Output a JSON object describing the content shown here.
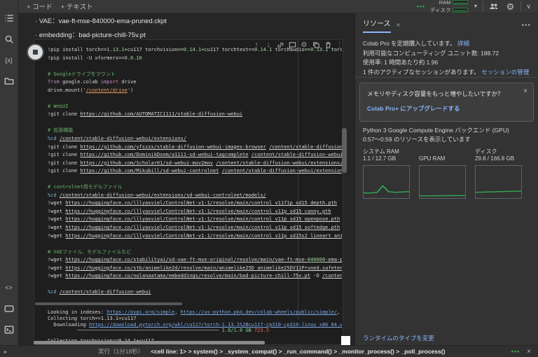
{
  "topbar": {
    "add_code": "+ コード",
    "add_text": "+ テキスト",
    "exec_dots": "•••",
    "ram_label": "RAM",
    "disk_label": "ディスク",
    "accent_green": "#34a853"
  },
  "markdown": {
    "bullet": "·",
    "line1": "VAE：vae-ft-mse-840000-ema-pruned.ckpt",
    "line2": "embedding：bad-picture-chill-75v.pt"
  },
  "cell": {
    "lines": [
      [
        [
          "pl",
          "!pip install torch=="
        ],
        [
          "nu",
          "1.13.1"
        ],
        [
          "pl",
          "+cu117 torchvision=="
        ],
        [
          "nu",
          "0.14.1"
        ],
        [
          "pl",
          "+cu117 torchtext=="
        ],
        [
          "nu",
          "0.14.1"
        ],
        [
          "pl",
          " torchaudio=="
        ],
        [
          "nu",
          "0.13.1"
        ],
        [
          "pl",
          " torch"
        ]
      ],
      [
        [
          "pl",
          "!pip install -U xformers=="
        ],
        [
          "nu",
          "0.0.16"
        ]
      ],
      [],
      [
        [
          "cm",
          "# Googleドライブをマウント"
        ]
      ],
      [
        [
          "kw",
          "from"
        ],
        [
          "pl",
          " google.colab "
        ],
        [
          "kw",
          "import"
        ],
        [
          "pl",
          " drive"
        ]
      ],
      [
        [
          "pl",
          "drive.mount("
        ],
        [
          "st",
          "'"
        ],
        [
          "stlk",
          "/content/drive"
        ],
        [
          "st",
          "'"
        ],
        [
          "pl",
          ")"
        ]
      ],
      [],
      [
        [
          "cm",
          "# WebUI"
        ]
      ],
      [
        [
          "pl",
          "!git clone "
        ],
        [
          "lk",
          "https://github.com/AUTOMATIC1111/stable-diffusion-webui"
        ]
      ],
      [],
      [
        [
          "cm",
          "# 拡張機能"
        ]
      ],
      [
        [
          "mg",
          "%cd"
        ],
        [
          "pl",
          " "
        ],
        [
          "lk",
          "/content/stable-diffusion-webui/extensions/"
        ]
      ],
      [
        [
          "pl",
          "!git clone "
        ],
        [
          "lk",
          "https://github.com/yfszzx/stable-diffusion-webui-images-browser"
        ],
        [
          "pl",
          " "
        ],
        [
          "lk",
          "/content/stable-diffusion-"
        ]
      ],
      [
        [
          "pl",
          "!git clone "
        ],
        [
          "lk",
          "https://github.com/DominikDoom/a1111-sd-webui-tagcomplete"
        ],
        [
          "pl",
          " "
        ],
        [
          "lk",
          "/content/stable-diffusion-webui/"
        ]
      ],
      [
        [
          "pl",
          "!git clone "
        ],
        [
          "lk",
          "https://github.com/Scholar01/sd-webui-mov2mov"
        ],
        [
          "pl",
          " "
        ],
        [
          "lk",
          "/content/stable-diffusion-webui/extensions/s"
        ]
      ],
      [
        [
          "pl",
          "!git clone "
        ],
        [
          "lk",
          "https://github.com/Mikubill/sd-webui-controlnet"
        ],
        [
          "pl",
          " "
        ],
        [
          "lk",
          "/content/stable-diffusion-webui/extensions"
        ]
      ],
      [],
      [
        [
          "cm",
          "# controlnet用モデルファイル"
        ]
      ],
      [
        [
          "mg",
          "%cd"
        ],
        [
          "pl",
          " "
        ],
        [
          "lk",
          "/content/stable-diffusion-webui/extensions/sd-webui-controlnet/models/"
        ]
      ],
      [
        [
          "pl",
          "!wget "
        ],
        [
          "lk",
          "https://huggingface.co/lllyasviel/ControlNet-v1-1/resolve/main/control_v11f1p_sd15_depth.pth"
        ]
      ],
      [
        [
          "pl",
          "!wget "
        ],
        [
          "lk",
          "https://huggingface.co/lllyasviel/ControlNet-v1-1/resolve/main/control_v11p_sd15_canny.pth"
        ]
      ],
      [
        [
          "pl",
          "!wget "
        ],
        [
          "lk",
          "https://huggingface.co/lllyasviel/ControlNet-v1-1/resolve/main/control_v11p_sd15_openpose.pth"
        ]
      ],
      [
        [
          "pl",
          "!wget "
        ],
        [
          "lk",
          "https://huggingface.co/lllyasviel/ControlNet-v1-1/resolve/main/control_v11p_sd15_softedge.pth"
        ]
      ],
      [
        [
          "pl",
          "!wget "
        ],
        [
          "lk",
          "https://huggingface.co/lllyasviel/ControlNet-v1-1/resolve/main/control_v11p_sd15s2_lineart_anim"
        ]
      ],
      [],
      [
        [
          "cm",
          "# VAEファイル、モデルファイルなど"
        ]
      ],
      [
        [
          "pl",
          "!wget "
        ],
        [
          "lk",
          "https://huggingface.co/stabilityai/sd-vae-ft-mse-original/resolve/main/vae-ft-mse-"
        ],
        [
          "lknu",
          "840000"
        ],
        [
          "lk",
          "-ema-pr"
        ]
      ],
      [
        [
          "pl",
          "!wget "
        ],
        [
          "lk",
          "https://huggingface.co/stb/animelike2d/resolve/main/animelike25D_animelike25DV11Pruned.safetens"
        ]
      ],
      [
        [
          "pl",
          "!wget "
        ],
        [
          "lk",
          "https://huggingface.co/nolanaatama/embeddings/resolve/main/bad-picture-chill-75v.pt"
        ],
        [
          "pl",
          " -O "
        ],
        [
          "lk",
          "/content"
        ]
      ],
      [],
      [
        [
          "mg",
          "%cd"
        ],
        [
          "pl",
          " "
        ],
        [
          "lk",
          "/content/stable-diffusion-webui"
        ]
      ]
    ]
  },
  "output": {
    "lines": [
      [
        [
          "pl",
          "Looking in indexes: "
        ],
        [
          "bl",
          "https://pypi.org/simple"
        ],
        [
          "pl",
          ", "
        ],
        [
          "bl",
          "https://us-python.pkg.dev/colab-wheels/public/simple/"
        ],
        [
          "pl",
          ", "
        ],
        [
          "bl",
          "ht"
        ]
      ],
      [
        [
          "pl",
          "Collecting torch==1.13.1+cu117"
        ]
      ],
      [
        [
          "pl",
          "  Downloading "
        ],
        [
          "bl",
          "https://download.pytorch.org/whl/cu117/torch-1.13.1%2Bcu117-cp310-cp310-linux_x86_64.whl"
        ]
      ],
      [
        [
          "pl",
          "          "
        ],
        [
          "bar",
          "────────────────────────────────────────────────"
        ],
        [
          "gn",
          " 1.8/1.8 GB "
        ],
        [
          "rd",
          "723.5"
        ]
      ],
      [
        [
          "pl",
          "Collecting torchvision==0.14.1+cu117"
        ]
      ]
    ]
  },
  "resources_panel": {
    "tab": "リソース",
    "close": "×",
    "menu_dots": "•••",
    "subscription": "Colab Pro を定期購入しています。",
    "details_link": "詳細",
    "units": "利用可能なコンピューティング ユニット数: 188.72",
    "usage": "使用率: 1 時間あたり約 1.96",
    "sessions": "1 件のアクティブなセッションがあります。",
    "sessions_link": "セッションの管理",
    "card_title": "メモリやディスク容量をもっと増やしたいですか？",
    "card_link": "Colab Pro+ にアップグレードする",
    "card_close": "×",
    "backend": "Python 3 Google Compute Engine バックエンド (GPU)",
    "range": "0:57～0:59 のリソースを表示しています",
    "runtime_link": "ランタイムのタイプを変更"
  },
  "chart_data": [
    {
      "type": "line",
      "title": "システム RAM",
      "subtitle": "1.1 / 12.7 GB",
      "x": [
        0,
        15,
        30,
        42,
        55,
        70,
        100
      ],
      "values": [
        16,
        16,
        18,
        38,
        20,
        18,
        20
      ],
      "ylim": [
        0,
        100
      ],
      "line_color": "#34a853"
    },
    {
      "type": "line",
      "title": "GPU RAM",
      "subtitle": "",
      "x": [
        0,
        100
      ],
      "values": [
        7,
        8
      ],
      "ylim": [
        0,
        100
      ],
      "line_color": "#34a853"
    },
    {
      "type": "line",
      "title": "ディスク",
      "subtitle": "29.8 / 166.8 GB",
      "x": [
        0,
        50,
        100
      ],
      "values": [
        18,
        20,
        22
      ],
      "ylim": [
        0,
        100
      ],
      "line_color": "#34a853"
    }
  ],
  "footer": {
    "expand_arrow": "▸",
    "status": "実行（1分18秒）",
    "breadcrumb": "<cell line: 1> > system() > _system_compat() > _run_command() > _monitor_process() > _poll_process()",
    "dots": "•••",
    "close": "×"
  }
}
